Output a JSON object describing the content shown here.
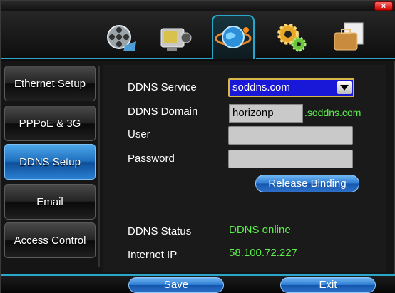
{
  "titlebar": {
    "close_label": "×"
  },
  "top_menu": [
    {
      "name": "film-reel-icon",
      "active": false
    },
    {
      "name": "camcorder-icon",
      "active": false
    },
    {
      "name": "network-globe-icon",
      "active": true
    },
    {
      "name": "gears-icon",
      "active": false
    },
    {
      "name": "briefcase-icon",
      "active": false
    }
  ],
  "sidebar": {
    "items": [
      {
        "label": "Ethernet Setup",
        "active": false
      },
      {
        "label": "PPPoE & 3G",
        "active": false
      },
      {
        "label": "DDNS Setup",
        "active": true
      },
      {
        "label": "Email",
        "active": false
      },
      {
        "label": "Access Control",
        "active": false
      }
    ]
  },
  "form": {
    "ddns_service_label": "DDNS Service",
    "ddns_service_value": "soddns.com",
    "ddns_domain_label": "DDNS Domain",
    "ddns_domain_value": "horizonp",
    "ddns_domain_suffix": ".soddns.com",
    "user_label": "User",
    "user_value": "",
    "password_label": "Password",
    "password_value": "",
    "release_binding_label": "Release Binding",
    "ddns_status_label": "DDNS Status",
    "ddns_status_value": "DDNS online",
    "internet_ip_label": "Internet IP",
    "internet_ip_value": "58.100.72.227"
  },
  "footer": {
    "save_label": "Save",
    "exit_label": "Exit"
  },
  "colors": {
    "accent": "#2aa7c8",
    "status_green": "#5cf04c",
    "select_bg": "#1a18d8",
    "active_tab": "#1e6fbe"
  }
}
